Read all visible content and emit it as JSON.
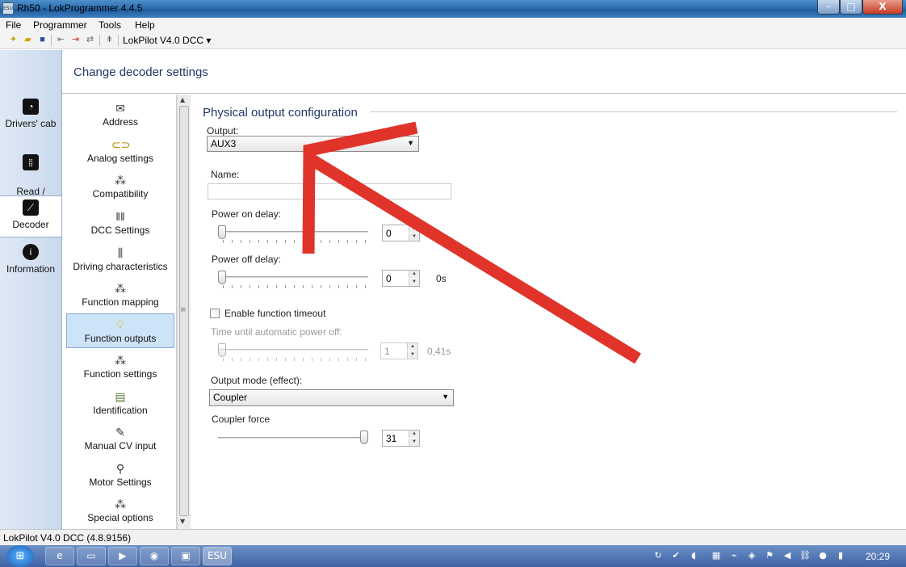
{
  "window": {
    "title": "Rh50 - LokProgrammer 4.4.5",
    "minimize": "–",
    "maximize": "□",
    "close": "X"
  },
  "menu": [
    "File",
    "Programmer",
    "Tools",
    "Help"
  ],
  "toolbar": {
    "decoder_select": "LokPilot V4.0 DCC ▾"
  },
  "leftnav": {
    "items": [
      {
        "label": "Drivers' cab",
        "icon": "gauge-icon"
      },
      {
        "label": "Read /\nWrite CVs",
        "icon": "read-write-icon"
      },
      {
        "label": "Decoder",
        "icon": "wrench-icon",
        "selected": true
      },
      {
        "label": "Information",
        "icon": "info-icon"
      }
    ]
  },
  "header": {
    "title": "Change decoder settings"
  },
  "categories": [
    {
      "label": "Address",
      "icon": "envelope-icon"
    },
    {
      "label": "Analog settings",
      "icon": "analog-icon"
    },
    {
      "label": "Compatibility",
      "icon": "buttons-icon"
    },
    {
      "label": "DCC Settings",
      "icon": "dcc-icon"
    },
    {
      "label": "Driving characteristics",
      "icon": "sliders-icon"
    },
    {
      "label": "Function mapping",
      "icon": "buttons-icon"
    },
    {
      "label": "Function outputs",
      "icon": "lightbulb-icon",
      "selected": true
    },
    {
      "label": "Function settings",
      "icon": "buttons-icon"
    },
    {
      "label": "Identification",
      "icon": "id-card-icon"
    },
    {
      "label": "Manual CV input",
      "icon": "pen-icon"
    },
    {
      "label": "Motor Settings",
      "icon": "motor-icon"
    },
    {
      "label": "Special options",
      "icon": "buttons-icon"
    }
  ],
  "panel": {
    "section_title": "Physical output configuration",
    "output_label": "Output:",
    "output_value": "AUX3",
    "name_label": "Name:",
    "name_value": "",
    "power_on_label": "Power on delay:",
    "power_on_value": "0",
    "power_on_level": 0,
    "power_off_label": "Power off delay:",
    "power_off_value": "0",
    "power_off_unit": "0s",
    "power_off_level": 0,
    "timeout_checkbox_label": "Enable function timeout",
    "timeout_checked": false,
    "auto_off_label": "Time until automatic power off:",
    "auto_off_value": "1",
    "auto_off_unit": "0,41s",
    "auto_off_level": 0,
    "mode_label": "Output mode (effect):",
    "mode_value": "Coupler",
    "coupler_force_label": "Coupler force",
    "coupler_force_value": "31",
    "coupler_force_level": 1.0
  },
  "status": {
    "text": "LokPilot V4.0 DCC (4.8.9156)"
  },
  "taskbar": {
    "clock": "20:29",
    "accent": "#3f63a6"
  },
  "annotation": {
    "color": "#e0342a"
  }
}
